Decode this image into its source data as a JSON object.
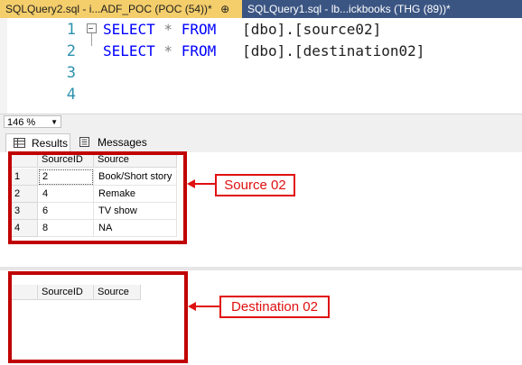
{
  "tabs": [
    {
      "label": "SQLQuery2.sql - i...ADF_POC (POC (54))*",
      "close": "⊕",
      "active": true
    },
    {
      "label": "SQLQuery1.sql - lb...ickbooks (THG (89))*",
      "active": false
    }
  ],
  "editor": {
    "lines": [
      {
        "num": "1",
        "kw1": "SELECT",
        "op": " * ",
        "kw2": "FROM",
        "obj": "   [dbo].[source02]"
      },
      {
        "num": "2",
        "kw1": "SELECT",
        "op": " * ",
        "kw2": "FROM",
        "obj": "   [dbo].[destination02]"
      },
      {
        "num": "3"
      },
      {
        "num": "4"
      }
    ]
  },
  "zoom": {
    "value": "146 %"
  },
  "result_tabs": {
    "results": "Results",
    "messages": "Messages"
  },
  "grid1": {
    "columns": [
      "SourceID",
      "Source"
    ],
    "rows": [
      {
        "n": "1",
        "id": "2",
        "source": "Book/Short story"
      },
      {
        "n": "2",
        "id": "4",
        "source": "Remake"
      },
      {
        "n": "3",
        "id": "6",
        "source": "TV show"
      },
      {
        "n": "4",
        "id": "8",
        "source": "NA"
      }
    ]
  },
  "grid2": {
    "columns": [
      "SourceID",
      "Source"
    ]
  },
  "annotations": {
    "callout1": "Source 02",
    "callout2": "Destination 02"
  },
  "colors": {
    "annotation": "#e01010",
    "active_tab": "#f4ce6b",
    "inactive_tab": "#3b5583"
  }
}
